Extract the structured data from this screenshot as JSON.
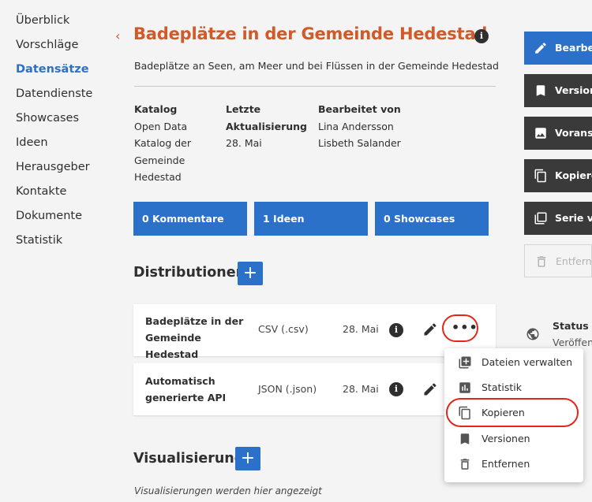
{
  "sidebar": {
    "items": [
      {
        "label": "Überblick"
      },
      {
        "label": "Vorschläge"
      },
      {
        "label": "Datensätze",
        "active": true
      },
      {
        "label": "Datendienste"
      },
      {
        "label": "Showcases"
      },
      {
        "label": "Ideen"
      },
      {
        "label": "Herausgeber"
      },
      {
        "label": "Kontakte"
      },
      {
        "label": "Dokumente"
      },
      {
        "label": "Statistik"
      }
    ]
  },
  "header": {
    "back_symbol": "‹",
    "title": "Badeplätze in der Gemeinde Hedestad",
    "info_symbol": "i",
    "description": "Badeplätze an Seen, am Meer und bei Flüssen in der Gemeinde Hedestad"
  },
  "meta": {
    "catalog_label": "Katalog",
    "catalog_value_lines": [
      "Open Data",
      "Katalog der",
      "Gemeinde",
      "Hedestad"
    ],
    "updated_label_lines": [
      "Letzte",
      "Aktualisierung"
    ],
    "updated_value": "28. Mai",
    "editors_label": "Bearbeitet von",
    "editors": [
      "Lina Andersson",
      "Lisbeth Salander"
    ]
  },
  "counters": {
    "comments": "0 Kommentare",
    "ideas": "1 Ideen",
    "showcases": "0 Showcases"
  },
  "distributions": {
    "title": "Distributionen",
    "add_symbol": "+",
    "rows": [
      {
        "name_lines": [
          "Badeplätze in der",
          "Gemeinde Hedestad"
        ],
        "format": "CSV (.csv)",
        "date": "28. Mai",
        "more_symbol": "•••"
      },
      {
        "name_lines": [
          "Automatisch",
          "generierte API"
        ],
        "format": "JSON (.json)",
        "date": "28. Mai",
        "more_symbol": "•••"
      }
    ]
  },
  "dropdown": {
    "items": [
      {
        "label": "Dateien verwalten",
        "icon": "files-icon"
      },
      {
        "label": "Statistik",
        "icon": "bar-chart-icon"
      },
      {
        "label": "Kopieren",
        "icon": "copy-icon",
        "highlighted": true
      },
      {
        "label": "Versionen",
        "icon": "bookmark-icon"
      },
      {
        "label": "Entfernen",
        "icon": "trash-icon"
      }
    ]
  },
  "visualisation": {
    "title": "Visualisierung",
    "add_symbol": "+",
    "note": "Visualisierungen werden hier angezeigt"
  },
  "right_actions": {
    "edit": "Bearbeiten",
    "versions": "Versionen",
    "preview": "Voransicht",
    "copy": "Kopieren",
    "series": "Serie verwalten",
    "remove": "Entfernen"
  },
  "status": {
    "label": "Status",
    "value": "Veröffentlicht"
  },
  "colors": {
    "accent_blue": "#2b70c9",
    "title_orange": "#d15a2a",
    "highlight_red": "#e0271a",
    "dark_button": "#3a3a3a"
  }
}
